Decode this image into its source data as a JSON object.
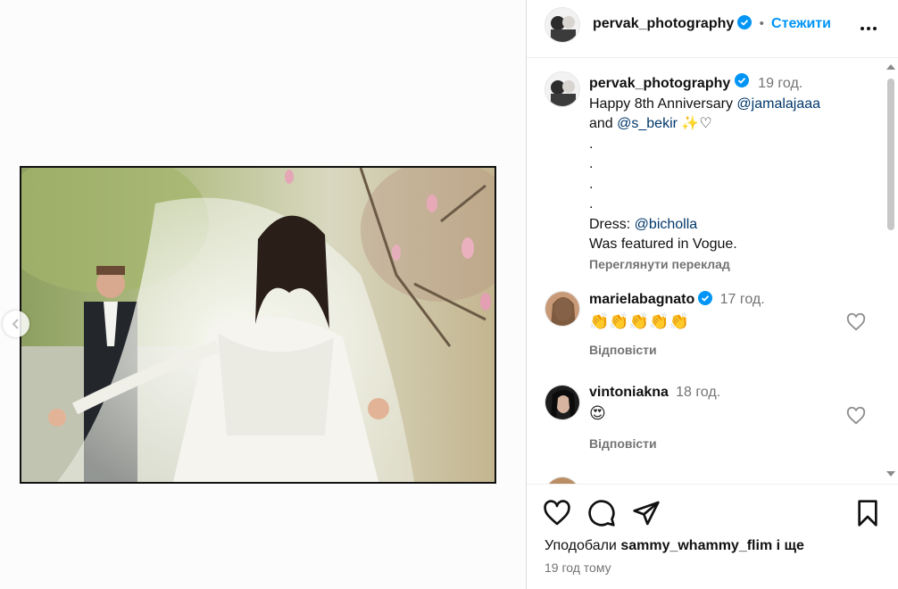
{
  "post": {
    "username": "pervak_photography",
    "follow_label": "Стежити",
    "caption": {
      "time": "19 год.",
      "text_start": "Happy 8th Anniversary ",
      "mention1": "@jamalajaaa",
      "and": "and ",
      "mention2": "@s_bekir",
      "sparkle": "✨",
      "heart": "♡",
      "dot": ".",
      "dress_label": "Dress: ",
      "mention3": "@bicholla",
      "vogue": "Was featured in Vogue.",
      "translate_label": "Переглянути переклад"
    }
  },
  "comments": [
    {
      "username": "marielabagnato",
      "time": "17 год.",
      "text": "👏👏👏👏👏",
      "reply_label": "Відповісти",
      "verified": true
    },
    {
      "username": "vintoniakna",
      "time": "18 год.",
      "text": "😍",
      "reply_label": "Відповісти",
      "verified": false
    }
  ],
  "footer": {
    "liked_by_prefix": "Уподобали ",
    "liked_by_user": "sammy_whammy_flim",
    "liked_by_suffix": " і ще",
    "posted_time": "19 год тому"
  },
  "colors": {
    "accent": "#0095f6",
    "mention": "#00376b",
    "muted": "#737373",
    "verified": "#0095f6"
  },
  "icons": [
    "more-icon",
    "verified-icon",
    "heart-icon",
    "comment-icon",
    "share-icon",
    "bookmark-icon",
    "chevron-left-icon"
  ]
}
